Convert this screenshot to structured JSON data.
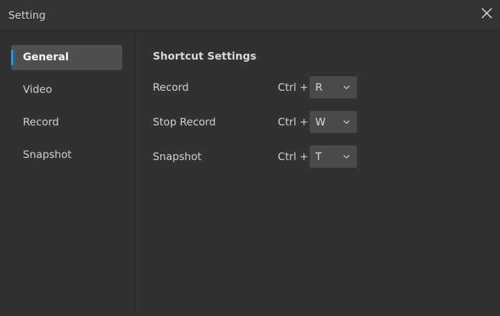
{
  "window": {
    "title": "Setting"
  },
  "sidebar": {
    "items": [
      {
        "label": "General",
        "active": true
      },
      {
        "label": "Video",
        "active": false
      },
      {
        "label": "Record",
        "active": false
      },
      {
        "label": "Snapshot",
        "active": false
      }
    ]
  },
  "main": {
    "section_title": "Shortcut Settings",
    "shortcuts": [
      {
        "label": "Record",
        "modifier": "Ctrl +",
        "key": "R"
      },
      {
        "label": "Stop Record",
        "modifier": "Ctrl +",
        "key": "W"
      },
      {
        "label": "Snapshot",
        "modifier": "Ctrl +",
        "key": "T"
      }
    ]
  },
  "icons": {
    "close": "close-icon",
    "dropdown": "chevron-down-icon"
  },
  "colors": {
    "background": "#323232",
    "active_item": "#505050",
    "accent": "#1e9ee8",
    "select_bg": "#4a4a4a"
  }
}
